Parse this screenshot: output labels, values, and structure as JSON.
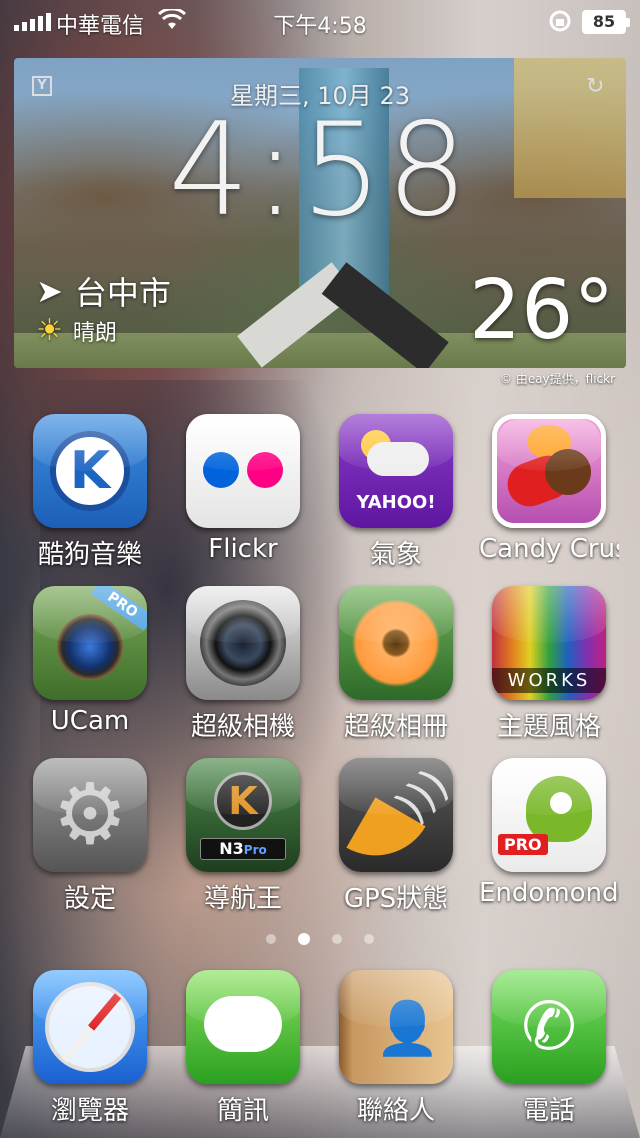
{
  "status_bar": {
    "carrier": "中華電信",
    "time": "下午4:58",
    "battery": "85"
  },
  "widget": {
    "date": "星期三, 10月 23",
    "clock": "4:58",
    "location": "台中市",
    "condition": "晴朗",
    "temperature": "26°",
    "credit": "© 由eay提供，flickr"
  },
  "apps": [
    {
      "label": "酷狗音樂",
      "icon": "kugou-music-icon"
    },
    {
      "label": "Flickr",
      "icon": "flickr-icon"
    },
    {
      "label": "氣象",
      "icon": "yahoo-weather-icon",
      "brand_text": "YAHOO!"
    },
    {
      "label": "Candy Crus",
      "icon": "candy-crush-icon"
    },
    {
      "label": "UCam",
      "icon": "ucam-icon",
      "badge": "PRO"
    },
    {
      "label": "超級相機",
      "icon": "super-camera-icon"
    },
    {
      "label": "超級相冊",
      "icon": "super-album-icon"
    },
    {
      "label": "主題風格",
      "icon": "themes-icon",
      "brand_text": "WORKS"
    },
    {
      "label": "設定",
      "icon": "settings-icon"
    },
    {
      "label": "導航王",
      "icon": "navking-icon",
      "brand_text": "N3",
      "badge": "Pro"
    },
    {
      "label": "GPS狀態",
      "icon": "gps-status-icon"
    },
    {
      "label": "Endomondo",
      "icon": "endomondo-icon",
      "badge": "PRO"
    }
  ],
  "page_dots": {
    "count": 4,
    "active": 1
  },
  "dock": [
    {
      "label": "瀏覽器",
      "icon": "safari-browser-icon"
    },
    {
      "label": "簡訊",
      "icon": "messages-icon"
    },
    {
      "label": "聯絡人",
      "icon": "contacts-icon"
    },
    {
      "label": "電話",
      "icon": "phone-icon"
    }
  ]
}
